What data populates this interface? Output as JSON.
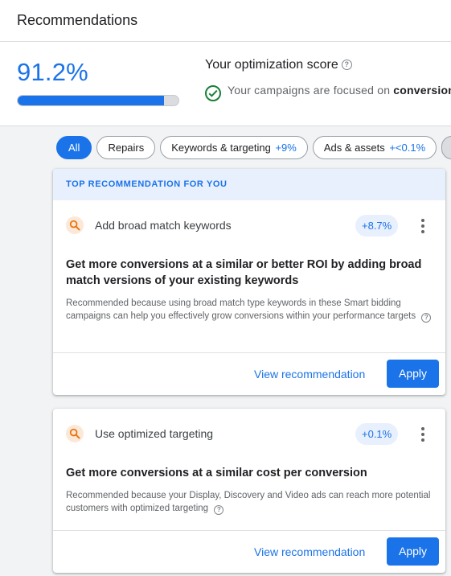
{
  "header": {
    "title": "Recommendations"
  },
  "score": {
    "value": "91.2%",
    "progress": 0.912,
    "title": "Your optimization score",
    "status_prefix": "Your campaigns are focused on ",
    "status_emphasis": "conversions"
  },
  "filters": [
    {
      "label": "All",
      "delta": ""
    },
    {
      "label": "Repairs",
      "delta": ""
    },
    {
      "label": "Keywords & targeting",
      "delta": "+9%"
    },
    {
      "label": "Ads & assets",
      "delta": "+<0.1%"
    }
  ],
  "top_banner": "TOP RECOMMENDATION FOR YOU",
  "recommendations": [
    {
      "title": "Add broad match keywords",
      "uplift": "+8.7%",
      "headline": "Get more conversions at a similar or better ROI by adding broad match versions of your existing keywords",
      "reason": "Recommended because using broad match type keywords in these Smart bidding campaigns can help you effectively grow conversions within your performance targets",
      "view_label": "View recommendation",
      "apply_label": "Apply"
    },
    {
      "title": "Use optimized targeting",
      "uplift": "+0.1%",
      "headline": "Get more conversions at a similar cost per conversion",
      "reason": "Recommended because your Display, Discovery and Video ads can reach more potential customers with optimized targeting",
      "view_label": "View recommendation",
      "apply_label": "Apply"
    }
  ],
  "colors": {
    "accent": "#1a73e8",
    "success": "#188038",
    "banner_bg": "#e8f0fe",
    "icon_orange": "#e8710a"
  },
  "icons": {
    "help": "help-circle-icon",
    "success": "check-circle-icon",
    "recommendation": "search-icon",
    "more": "more-vert-icon"
  }
}
